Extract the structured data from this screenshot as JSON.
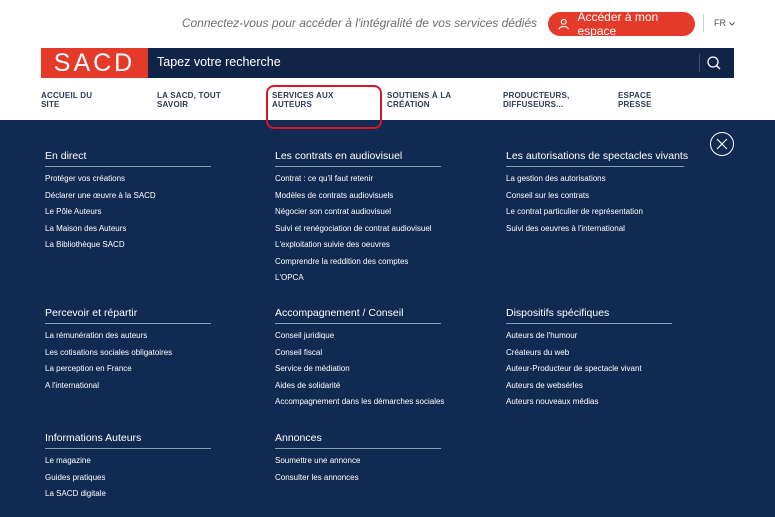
{
  "header": {
    "tagline": "Connectez-vous pour accéder à l'intégralité de vos services dédiés",
    "login_label": "Accéder à mon espace",
    "lang_label": "FR",
    "logo": "SACD",
    "search_placeholder": "Tapez votre recherche"
  },
  "nav": {
    "items": [
      {
        "line1": "ACCUEIL DU",
        "line2": "SITE"
      },
      {
        "line1": "LA SACD, TOUT",
        "line2": "SAVOIR"
      },
      {
        "line1": "SERVICES AUX",
        "line2": "AUTEURS"
      },
      {
        "line1": "SOUTIENS À LA",
        "line2": "CRÉATION"
      },
      {
        "line1": "PRODUCTEURS,",
        "line2": "DIFFUSEURS..."
      },
      {
        "line1": "ESPACE",
        "line2": "PRESSE"
      }
    ]
  },
  "menu": {
    "sections": [
      {
        "title": "En direct",
        "links": [
          "Protéger vos créations",
          "Déclarer une œuvre à la SACD",
          "Le Pôle Auteurs",
          "La Maison des Auteurs",
          "La Bibliothèque SACD"
        ]
      },
      {
        "title": "Les contrats en audiovisuel",
        "links": [
          "Contrat : ce qu'il faut retenir",
          "Modèles de contrats audiovisuels",
          "Négocier son contrat audiovisuel",
          "Suivi et renégociation de contrat audiovisuel",
          "L'exploitation suivie des oeuvres",
          "Comprendre la reddition des comptes",
          "L'OPCA"
        ]
      },
      {
        "title": "Les autorisations de spectacles vivants",
        "links": [
          "La gestion des autorisations",
          "Conseil sur les contrats",
          "Le contrat particulier de représentation",
          "Suivi des oeuvres à l'international"
        ]
      },
      {
        "title": "Percevoir et répartir",
        "links": [
          "La rémunération des auteurs",
          "Les cotisations sociales obligatoires",
          "La perception en France",
          "A l'international"
        ]
      },
      {
        "title": "Accompagnement / Conseil",
        "links": [
          "Conseil juridique",
          "Conseil fiscal",
          "Service de médiation",
          "Aides de solidarité",
          "Accompagnement dans les démarches sociales"
        ]
      },
      {
        "title": "Dispositifs spécifiques",
        "links": [
          "Auteurs de l'humour",
          "Créateurs du web",
          "Auteur-Producteur de spectacle vivant",
          "Auteurs de websérles",
          "Auteurs nouveaux médias"
        ]
      },
      {
        "title": "Informations Auteurs",
        "links": [
          "Le magazine",
          "Guides pratiques",
          "La SACD digitale"
        ]
      },
      {
        "title": "Annonces",
        "links": [
          "Soumettre une annonce",
          "Consulter les annonces"
        ]
      }
    ]
  },
  "colors": {
    "brand_red": "#e33a2a",
    "navy": "#112a52",
    "annotation_red": "#d8162b"
  }
}
